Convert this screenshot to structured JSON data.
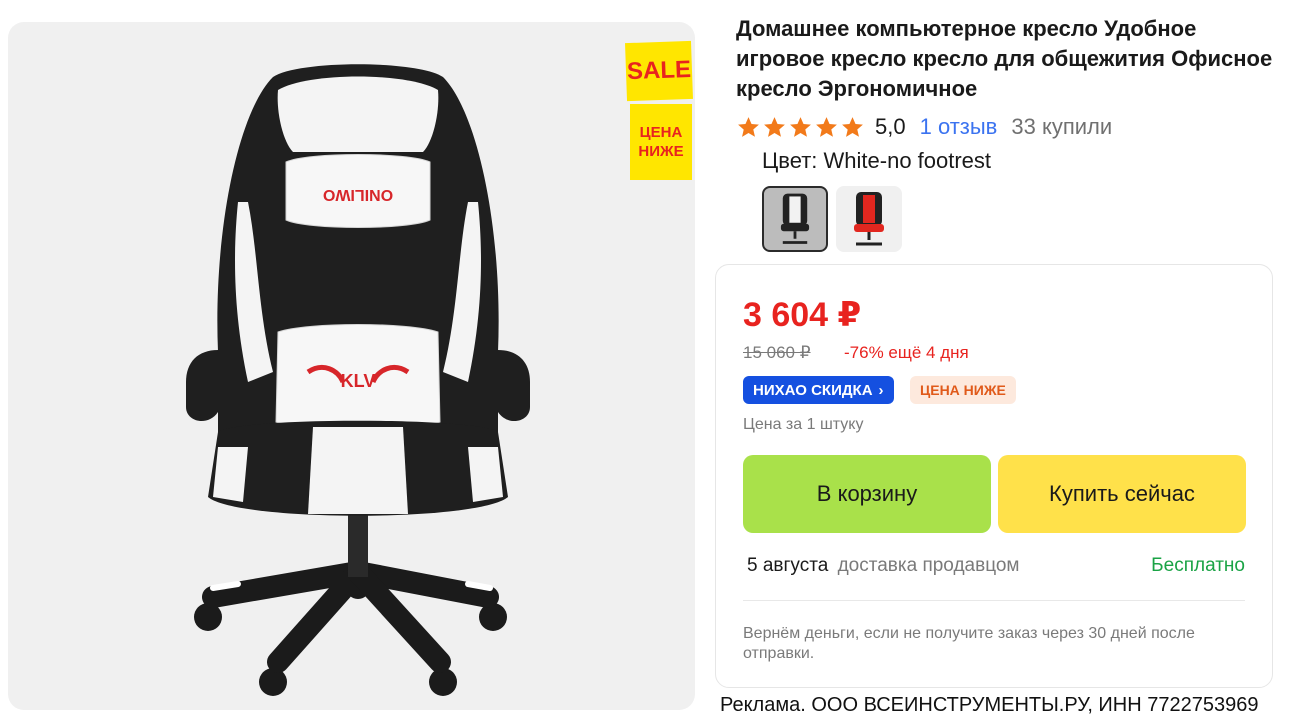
{
  "product": {
    "title": "Домашнее компьютерное кресло Удобное игровое кресло кресло для общежития Офисное кресло Эргономичное",
    "rating": {
      "stars": 5,
      "value": "5,0",
      "reviews_label": "1 отзыв",
      "purchased_label": "33 купили"
    },
    "color_label": "Цвет: White-no footrest",
    "variants": [
      {
        "name": "White-no footrest",
        "selected": true
      },
      {
        "name": "Red",
        "selected": false
      }
    ],
    "image_brand_text": "KLV",
    "pillow_text": "ONILIWO"
  },
  "sale_badge": {
    "top": "SALE",
    "bottom_line1": "ЦЕНА",
    "bottom_line2": "НИЖЕ"
  },
  "buy_box": {
    "price": "3 604 ₽",
    "old_price": "15 060 ₽",
    "discount": "-76% ещё 4 дня",
    "promo_label": "НИХАО СКИДКА",
    "promo_chevron": "›",
    "cheaper_label": "ЦЕНА НИЖЕ",
    "unit_price": "Цена за 1 штуку",
    "cart_button": "В корзину",
    "buy_now_button": "Купить сейчас",
    "delivery_date": "5 августа",
    "delivery_method": "доставка продавцом",
    "delivery_price": "Бесплатно",
    "guarantee": "Вернём деньги, если не получите заказ через 30 дней после отправки."
  },
  "ad_disclaimer": "Реклама. ООО ВСЕИНСТРУМЕНТЫ.РУ, ИНН 7722753969",
  "colors": {
    "price_red": "#e8231f",
    "link_blue": "#3b73f0",
    "star_orange": "#f27a1a",
    "cart_green": "#a9e14a",
    "buy_yellow": "#ffe14a",
    "promo_blue": "#1550e0",
    "free_green": "#1aa345"
  }
}
